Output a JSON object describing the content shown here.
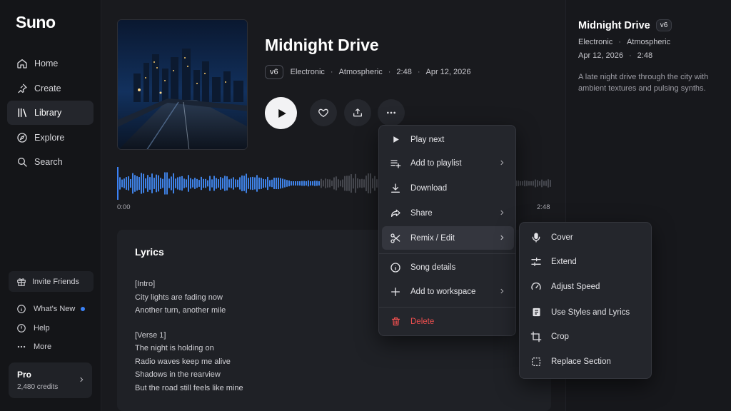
{
  "app": {
    "name": "Suno"
  },
  "sidebar": {
    "items": [
      {
        "label": "Home",
        "icon": "home-icon"
      },
      {
        "label": "Create",
        "icon": "pin-icon"
      },
      {
        "label": "Library",
        "icon": "library-icon"
      },
      {
        "label": "Explore",
        "icon": "compass-icon"
      },
      {
        "label": "Search",
        "icon": "search-icon"
      }
    ],
    "active": "Library",
    "invite_label": "Invite Friends",
    "small_items": [
      {
        "label": "What's New",
        "icon": "info-icon"
      },
      {
        "label": "Help",
        "icon": "help-icon"
      },
      {
        "label": "More",
        "icon": "more-icon"
      }
    ],
    "plan": {
      "title": "Pro",
      "credits": "2,480 credits"
    }
  },
  "song": {
    "title": "Midnight Drive",
    "version": "v6",
    "genre": "Electronic",
    "mood": "Atmospheric",
    "duration": "2:48",
    "date": "Apr 12, 2026",
    "time_start": "0:00",
    "time_end": "2:48",
    "progress": 0.47,
    "description": "A late night drive through the city with ambient textures and pulsing synths."
  },
  "lyrics": {
    "title": "Lyrics",
    "lines": [
      "[Intro]",
      "City lights are fading now",
      "Another turn, another mile",
      "",
      "[Verse 1]",
      "The night is holding on",
      "Radio waves keep me alive",
      "Shadows in the rearview",
      "But the road still feels like mine"
    ]
  },
  "menu": {
    "items": [
      {
        "label": "Play next",
        "icon": "play-icon",
        "submenu": false
      },
      {
        "label": "Add to playlist",
        "icon": "playlist-add-icon",
        "submenu": true
      },
      {
        "label": "Download",
        "icon": "download-icon",
        "submenu": false
      },
      {
        "label": "Share",
        "icon": "share-icon",
        "submenu": true
      },
      {
        "label": "Remix / Edit",
        "icon": "scissors-icon",
        "submenu": true
      },
      {
        "label": "Song details",
        "icon": "info-icon",
        "submenu": false
      },
      {
        "label": "Add to workspace",
        "icon": "plus-icon",
        "submenu": true
      },
      {
        "label": "Delete",
        "icon": "trash-icon",
        "submenu": false
      }
    ]
  },
  "submenu": {
    "items": [
      {
        "label": "Cover",
        "icon": "mic-icon"
      },
      {
        "label": "Extend",
        "icon": "extend-icon"
      },
      {
        "label": "Adjust Speed",
        "icon": "speedometer-icon"
      },
      {
        "label": "Use Styles and Lyrics",
        "icon": "document-icon"
      },
      {
        "label": "Crop",
        "icon": "crop-icon"
      },
      {
        "label": "Replace Section",
        "icon": "replace-section-icon"
      }
    ]
  },
  "colors": {
    "accent": "#3b82f6",
    "danger": "#ef4f4f",
    "wave_played": "#3f82e6",
    "wave_unplayed": "#45474e"
  }
}
